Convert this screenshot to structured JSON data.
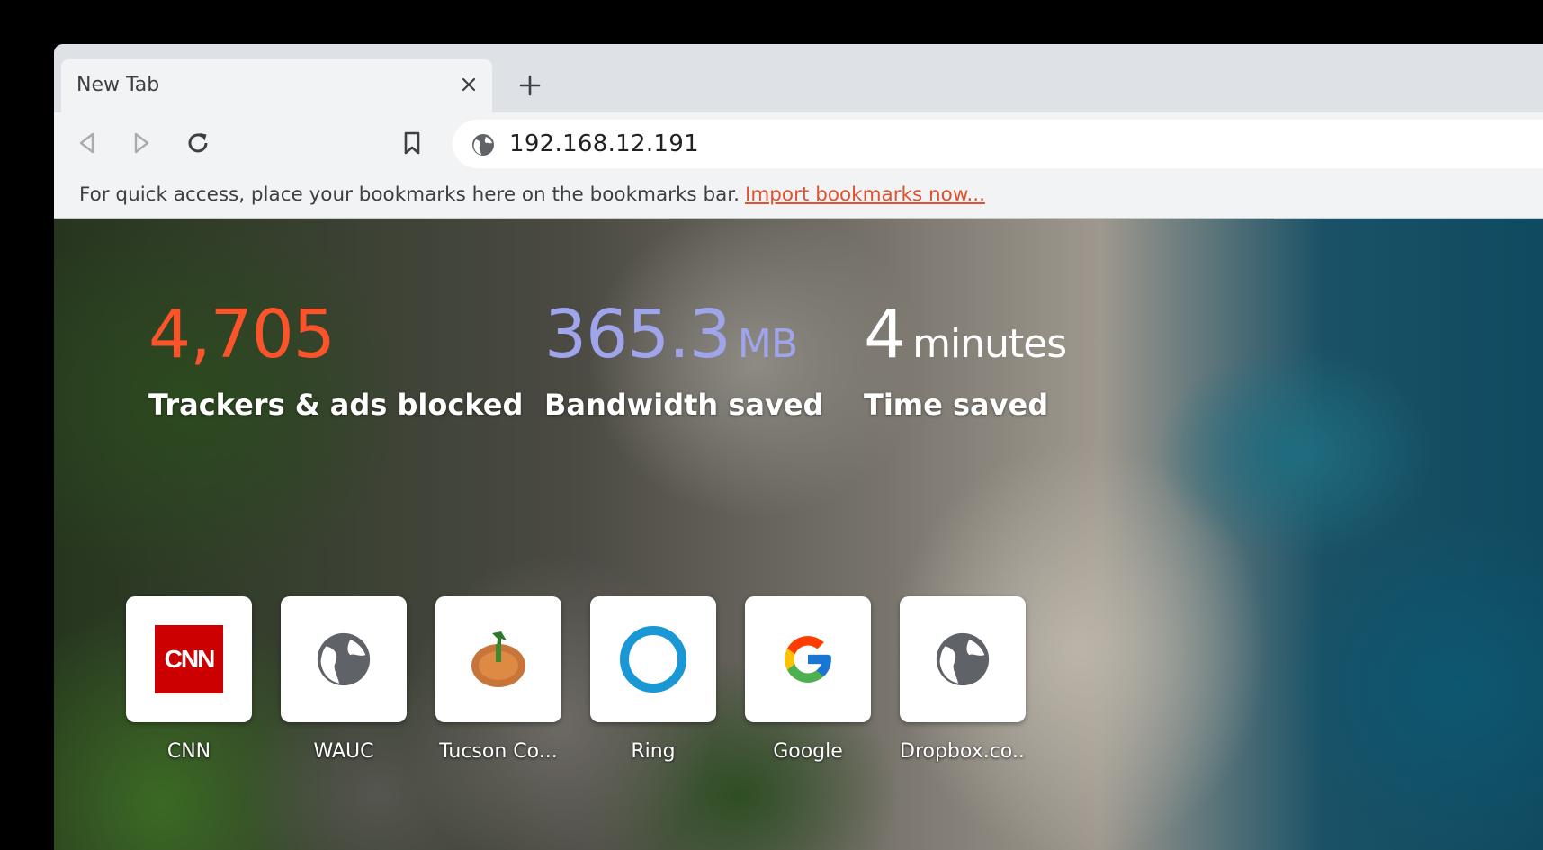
{
  "tab": {
    "title": "New Tab"
  },
  "toolbar": {
    "address": "192.168.12.191"
  },
  "bookmarks_bar": {
    "message": "For quick access, place your bookmarks here on the bookmarks bar.",
    "import_link": "Import bookmarks now..."
  },
  "stats": [
    {
      "value": "4,705",
      "unit": "",
      "label": "Trackers & ads blocked",
      "color": "#fb542b"
    },
    {
      "value": "365.3",
      "unit": "MB",
      "label": "Bandwidth saved",
      "color": "#a0a5eb"
    },
    {
      "value": "4",
      "unit": "minutes",
      "label": "Time saved",
      "color": "#ffffff"
    }
  ],
  "top_sites": [
    {
      "label": "CNN",
      "icon": "cnn-logo-icon"
    },
    {
      "label": "WAUC",
      "icon": "globe-icon"
    },
    {
      "label": "Tucson Co...",
      "icon": "tucson-favicon-icon"
    },
    {
      "label": "Ring",
      "icon": "ring-logo-icon"
    },
    {
      "label": "Google",
      "icon": "google-logo-icon"
    },
    {
      "label": "Dropbox.co...",
      "icon": "globe-icon"
    }
  ],
  "colors": {
    "accent": "#fb542b",
    "link": "#e2512f",
    "chrome": "#dee1e6",
    "toolbar": "#f2f3f4"
  }
}
